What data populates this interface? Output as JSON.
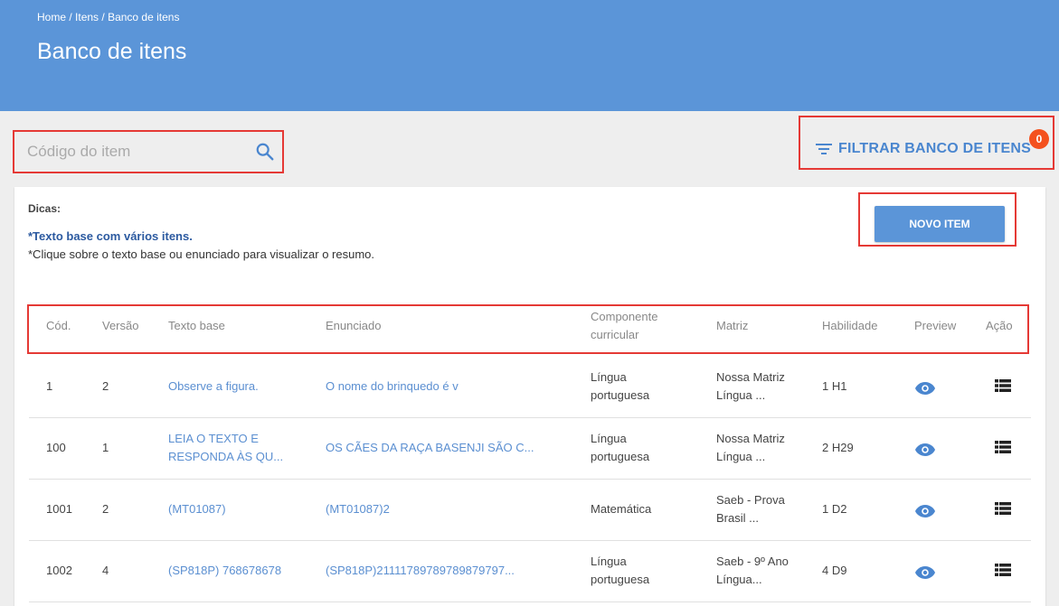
{
  "header": {
    "breadcrumb": [
      "Home",
      "Itens",
      "Banco de itens"
    ],
    "breadcrumb_sep": " / ",
    "title": "Banco de itens"
  },
  "search": {
    "placeholder": "Código do item",
    "value": ""
  },
  "filter": {
    "label": "FILTRAR BANCO DE ITENS",
    "badge": "0"
  },
  "tips": {
    "title": "Dicas:",
    "line1": "*Texto base com vários itens.",
    "line2": "*Clique sobre o texto base ou enunciado para visualizar o resumo."
  },
  "new_item_label": "NOVO ITEM",
  "table": {
    "headers": {
      "code": "Cód.",
      "version": "Versão",
      "base_text": "Texto base",
      "statement": "Enunciado",
      "component_1": "Componente",
      "component_2": "curricular",
      "matrix": "Matriz",
      "skill": "Habilidade",
      "preview": "Preview",
      "action": "Ação"
    },
    "rows": [
      {
        "code": "1",
        "version": "2",
        "base_1": "Observe a figura.",
        "base_2": "",
        "statement": "O nome do brinquedo é v",
        "comp_1": "Língua",
        "comp_2": "portuguesa",
        "matrix_1": "Nossa Matriz",
        "matrix_2": "Língua ...",
        "skill": "1 H1"
      },
      {
        "code": "100",
        "version": "1",
        "base_1": "LEIA O TEXTO E",
        "base_2": "RESPONDA ÀS QU...",
        "statement": "OS CÃES DA RAÇA BASENJI SÃO C...",
        "comp_1": "Língua",
        "comp_2": "portuguesa",
        "matrix_1": "Nossa Matriz",
        "matrix_2": "Língua ...",
        "skill": "2 H29"
      },
      {
        "code": "1001",
        "version": "2",
        "base_1": "(MT01087)",
        "base_2": "",
        "statement": "(MT01087)2",
        "comp_1": "Matemática",
        "comp_2": "",
        "matrix_1": "Saeb - Prova",
        "matrix_2": "Brasil ...",
        "skill": "1 D2"
      },
      {
        "code": "1002",
        "version": "4",
        "base_1": "(SP818P) 768678678",
        "base_2": "",
        "statement": "(SP818P)21111789789789879797...",
        "comp_1": "Língua",
        "comp_2": "portuguesa",
        "matrix_1": "Saeb - 9º Ano",
        "matrix_2": "Língua...",
        "skill": "4 D9"
      }
    ]
  },
  "colors": {
    "header_bg": "#5b95d8",
    "accent": "#4a86cf",
    "badge": "#f4511e",
    "highlight": "#e53935"
  },
  "icons": {
    "search": "search-icon",
    "filter": "filter-icon",
    "preview": "eye-icon",
    "action": "list-icon"
  }
}
